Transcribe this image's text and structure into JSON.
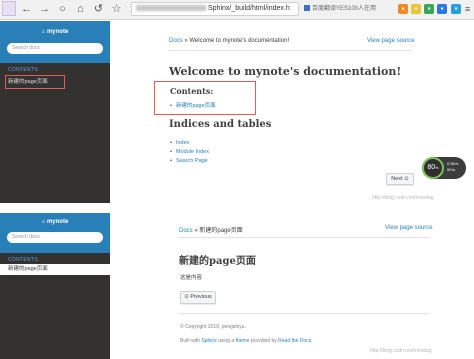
{
  "browser": {
    "address": "Sphinx/_build/html/index.h",
    "bookmark_text": "百度翻译YES100人在用",
    "nav": [
      "←",
      "→",
      "○",
      "⌂",
      "↺",
      "☆"
    ]
  },
  "top": {
    "sidebar": {
      "logo": "mynote",
      "search_placeholder": "Search docs",
      "caption": "CONTENTS:",
      "items": [
        "新建的page页面"
      ]
    },
    "breadcrumb": {
      "home": "Docs",
      "sep": "»",
      "current": "Welcome to mynote's documentation!"
    },
    "view_source": "View page source",
    "title": "Welcome to mynote's documentation!",
    "contents_heading": "Contents:",
    "contents_items": [
      "新建的page页面"
    ],
    "indices_heading": "Indices and tables",
    "indices_items": [
      "Index",
      "Module Index",
      "Search Page"
    ],
    "next_button": "Next ⊙",
    "speed_badge": {
      "value": "80",
      "unit": "%",
      "up": "0.5K/s",
      "down": "0K/s"
    },
    "watermark": "http://blog.csdn.net/moodag"
  },
  "bottom": {
    "sidebar": {
      "logo": "mynote",
      "search_placeholder": "Search docs",
      "caption": "CONTENTS:",
      "items": [
        "新建的page页面"
      ]
    },
    "breadcrumb": {
      "home": "Docs",
      "sep": "»",
      "current": "新建的page页面"
    },
    "view_source": "View page source",
    "title": "新建的page页面",
    "body": "这是内容",
    "previous_button": "⊙ Previous",
    "copyright": "© Copyright 2018, pengshiyu.",
    "built_with": {
      "prefix": "Built with",
      "sphinx": "Sphinx",
      "mid": "using a",
      "theme": "theme",
      "provided": "provided by",
      "rtd": "Read the Docs."
    },
    "watermark": "http://blog.csdn.net/moodag"
  }
}
